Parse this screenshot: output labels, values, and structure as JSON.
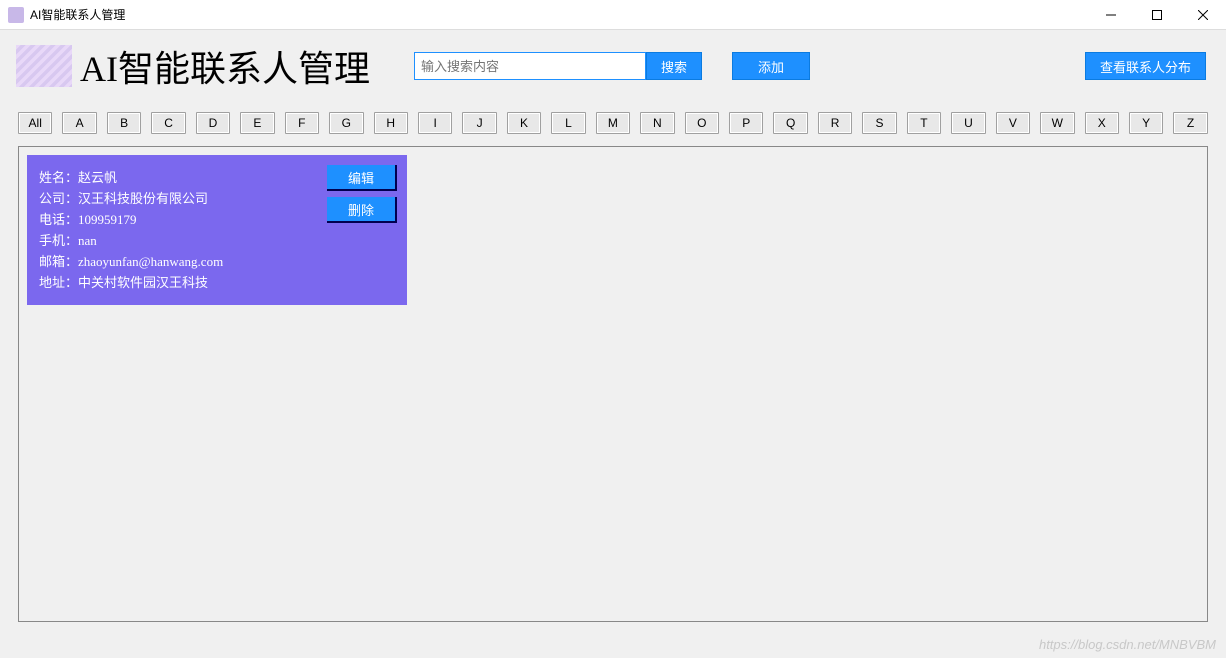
{
  "window": {
    "title": "AI智能联系人管理"
  },
  "header": {
    "title": "AI智能联系人管理",
    "searchPlaceholder": "输入搜索内容",
    "searchBtn": "搜索",
    "addBtn": "添加",
    "viewDistBtn": "查看联系人分布"
  },
  "alpha": {
    "all": "All",
    "letters": [
      "A",
      "B",
      "C",
      "D",
      "E",
      "F",
      "G",
      "H",
      "I",
      "J",
      "K",
      "L",
      "M",
      "N",
      "O",
      "P",
      "Q",
      "R",
      "S",
      "T",
      "U",
      "V",
      "W",
      "X",
      "Y",
      "Z"
    ]
  },
  "contact": {
    "nameLabel": "姓名：",
    "nameValue": "赵云帆",
    "companyLabel": "公司：",
    "companyValue": "汉王科技股份有限公司",
    "phoneLabel": "电话：",
    "phoneValue": "109959179",
    "mobileLabel": "手机：",
    "mobileValue": "nan",
    "emailLabel": "邮箱：",
    "emailValue": "zhaoyunfan@hanwang.com",
    "addressLabel": "地址：",
    "addressValue": "中关村软件园汉王科技",
    "editBtn": "编辑",
    "deleteBtn": "删除"
  },
  "watermark": "https://blog.csdn.net/MNBVBM"
}
